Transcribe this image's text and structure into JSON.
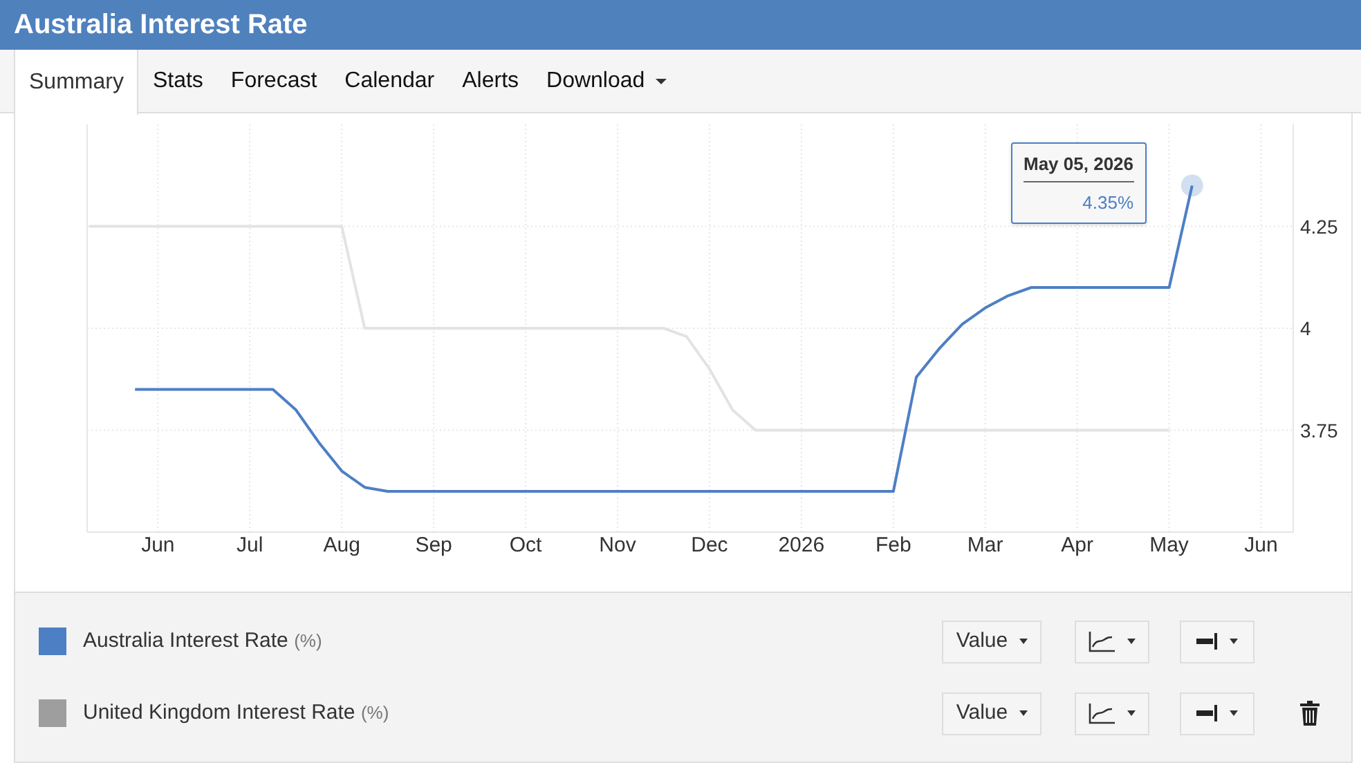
{
  "header": {
    "title": "Australia Interest Rate"
  },
  "tabs": [
    {
      "label": "Summary",
      "selected": true
    },
    {
      "label": "Stats",
      "selected": false
    },
    {
      "label": "Forecast",
      "selected": false
    },
    {
      "label": "Calendar",
      "selected": false
    },
    {
      "label": "Alerts",
      "selected": false
    },
    {
      "label": "Download",
      "selected": false,
      "dropdown": true
    }
  ],
  "chart": {
    "chart_data": {
      "type": "line",
      "categories": [
        null,
        null,
        null,
        "Jun",
        null,
        null,
        null,
        "Jul",
        null,
        null,
        null,
        "Aug",
        null,
        null,
        null,
        "Sep",
        null,
        null,
        null,
        "Oct",
        null,
        null,
        null,
        "Nov",
        null,
        null,
        null,
        "Dec",
        null,
        null,
        null,
        "2026",
        null,
        null,
        null,
        "Feb",
        null,
        null,
        null,
        "Mar",
        null,
        null,
        null,
        "Apr",
        null,
        null,
        null,
        "May",
        null,
        null,
        null,
        "Jun",
        null
      ],
      "series": [
        {
          "name": "Australia Interest Rate",
          "color": "#4d7fc4",
          "values": [
            null,
            null,
            3.85,
            3.85,
            3.85,
            3.85,
            3.85,
            3.85,
            3.85,
            3.8,
            3.72,
            3.65,
            3.61,
            3.6,
            3.6,
            3.6,
            3.6,
            3.6,
            3.6,
            3.6,
            3.6,
            3.6,
            3.6,
            3.6,
            3.6,
            3.6,
            3.6,
            3.6,
            3.6,
            3.6,
            3.6,
            3.6,
            3.6,
            3.6,
            3.6,
            3.6,
            3.88,
            3.95,
            4.01,
            4.05,
            4.08,
            4.1,
            4.1,
            4.1,
            4.1,
            4.1,
            4.1,
            4.1,
            4.35,
            null,
            null,
            null,
            null
          ]
        },
        {
          "name": "United Kingdom Interest Rate",
          "color": "#e3e3e3",
          "values": [
            4.25,
            4.25,
            4.25,
            4.25,
            4.25,
            4.25,
            4.25,
            4.25,
            4.25,
            4.25,
            4.25,
            4.25,
            4.0,
            4.0,
            4.0,
            4.0,
            4.0,
            4.0,
            4.0,
            4.0,
            4.0,
            4.0,
            4.0,
            4.0,
            4.0,
            4.0,
            3.98,
            3.9,
            3.8,
            3.75,
            3.75,
            3.75,
            3.75,
            3.75,
            3.75,
            3.75,
            3.75,
            3.75,
            3.75,
            3.75,
            3.75,
            3.75,
            3.75,
            3.75,
            3.75,
            3.75,
            3.75,
            3.75,
            null,
            null,
            null,
            null,
            null
          ]
        }
      ],
      "ylim": [
        3.5,
        4.5
      ],
      "grid": true,
      "yticks": [
        3.75,
        4,
        4.25
      ]
    },
    "tooltip": {
      "title": "May 05, 2026",
      "value": "4.35%"
    }
  },
  "legend": [
    {
      "unit": "(%)",
      "color": "#4d7fc4",
      "value_button": "Value",
      "deletable": false
    },
    {
      "unit": "(%)",
      "color": "#9e9e9e",
      "value_button": "Value",
      "deletable": true
    }
  ]
}
